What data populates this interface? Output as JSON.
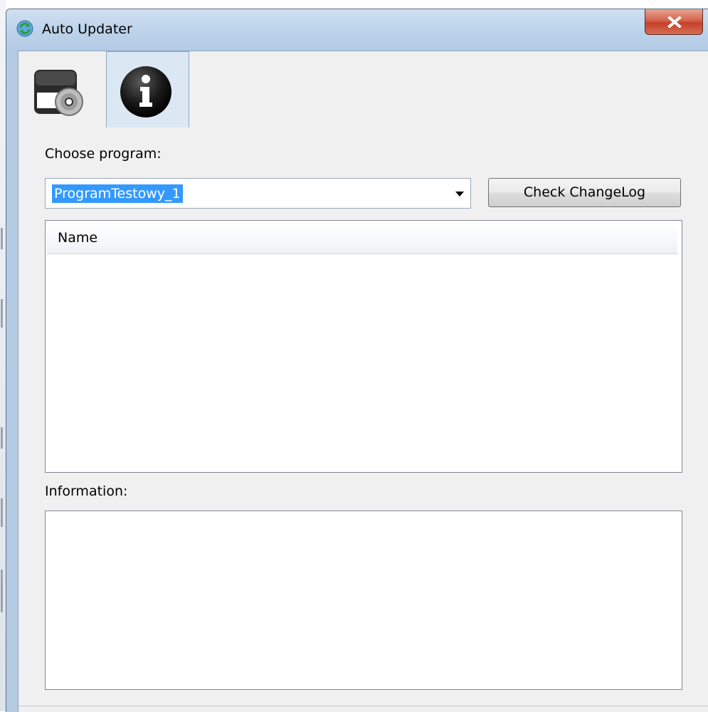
{
  "window": {
    "title": "Auto Updater"
  },
  "tabs": [
    {
      "icon": "install-disc-icon",
      "selected": false
    },
    {
      "icon": "info-icon",
      "selected": true
    }
  ],
  "form": {
    "choose_label": "Choose program:",
    "program_value": "ProgramTestowy_1",
    "check_button": "Check ChangeLog",
    "list_header": "Name",
    "info_label": "Information:"
  },
  "colors": {
    "selection": "#3399ff",
    "titlebar": "#bcd2ea",
    "close": "#c6412a"
  }
}
